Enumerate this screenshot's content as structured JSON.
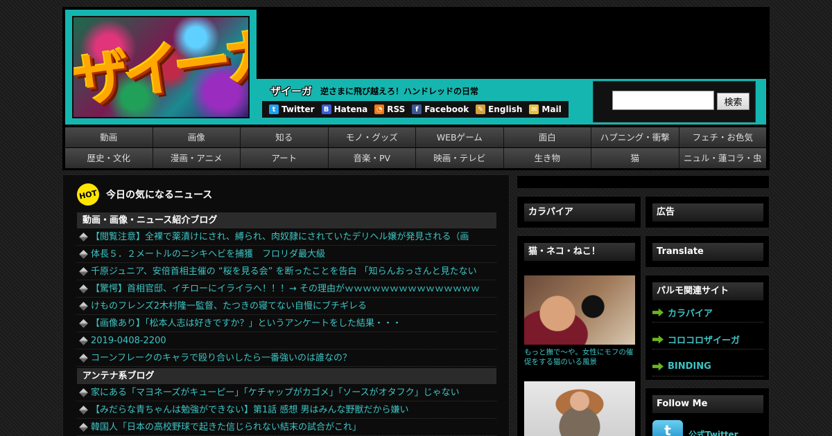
{
  "header": {
    "logo_text": "ザイーガ",
    "site_name": "ザイーガ",
    "tagline": "逆さまに飛び越えろ！ハンドレッドの日常",
    "social": [
      {
        "label": "Twitter",
        "icon": "twitter-icon",
        "color": "#1da1f2",
        "glyph": "t"
      },
      {
        "label": "Hatena",
        "icon": "hatena-icon",
        "color": "#3b5fd6",
        "glyph": "B"
      },
      {
        "label": "RSS",
        "icon": "rss-icon",
        "color": "#f07a1a",
        "glyph": "◔"
      },
      {
        "label": "Facebook",
        "icon": "facebook-icon",
        "color": "#3b5998",
        "glyph": "f"
      },
      {
        "label": "English",
        "icon": "pencil-icon",
        "color": "#d6a23a",
        "glyph": "✎"
      },
      {
        "label": "Mail",
        "icon": "mail-icon",
        "color": "#e8c040",
        "glyph": "✉"
      }
    ],
    "search": {
      "value": "",
      "button_label": "検索"
    }
  },
  "nav": {
    "row1": [
      "動画",
      "画像",
      "知る",
      "モノ・グッズ",
      "WEBゲーム",
      "面白",
      "ハプニング・衝撃",
      "フェチ・お色気"
    ],
    "row2": [
      "歴史・文化",
      "漫画・アニメ",
      "アート",
      "音楽・PV",
      "映画・テレビ",
      "生き物",
      "猫",
      "ニュル・蓮コラ・虫"
    ]
  },
  "main": {
    "hot_badge": "HOT",
    "hot_title": "今日の気になるニュース",
    "section1": {
      "title": "動画・画像・ニュース紹介ブログ",
      "items": [
        "【閲覧注意】全裸で薬漬けにされ、縛られ、肉奴隷にされていたデリヘル嬢が発見される（画",
        "体長５．２メートルのニシキヘビを捕獲　フロリダ最大級",
        "千原ジュニア、安倍首相主催の “桜を見る会” を断ったことを告白 「知らんおっさんと見たない",
        "【驚愕】首相官邸、イチローにイライラへ！！！→ その理由がｗｗｗｗｗｗｗｗｗｗｗｗｗｗｗ",
        "けものフレンズ2木村隆一監督、たつきの寝てない自慢にブチギレる",
        "【画像あり】「松本人志は好きですか？」というアンケートをした結果・・・",
        "2019-0408-2200",
        "コーンフレークのキャラで殴り合いしたら一番強いのは誰なの？"
      ]
    },
    "section2": {
      "title": "アンテナ系ブログ",
      "items": [
        "家にある「マヨネーズがキューピー」「ケチャップがカゴメ」「ソースがオタフク」じゃない",
        "【みだらな青ちゃんは勉強ができない】第1話 感想 男はみんな野獣だから嫌い",
        "韓国人「日本の高校野球で起きた信じられない結末の試合がこれ」"
      ]
    }
  },
  "sidebar_mid": {
    "karapaia_title": "カラパイア",
    "cats_title": "猫・ネコ・ねこ！",
    "cat_caption": "もっと撫で～や。女性にモフの催促をする猫のいる風景"
  },
  "sidebar_right": {
    "ad_title": "広告",
    "translate_title": "Translate",
    "related_title": "パルモ関連サイト",
    "related_links": [
      "カラパイア",
      "コロコロザイーガ",
      "BINDING"
    ],
    "follow_title": "Follow Me",
    "follow_twitter": "公式Twitter"
  }
}
